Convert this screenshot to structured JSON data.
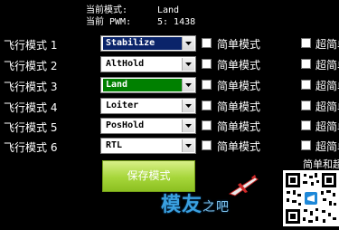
{
  "status": {
    "current_mode_label": "当前模式:",
    "current_mode_value": "Land",
    "current_pwm_label": "当前 PWM:",
    "current_pwm_value": "5: 1438"
  },
  "modes": [
    {
      "label": "飞行模式 1",
      "value": "Stabilize",
      "bg": "#0a246a",
      "simple": "简单模式",
      "super": "超简单模式"
    },
    {
      "label": "飞行模式 2",
      "value": "AltHold",
      "bg": "#ffffff",
      "simple": "简单模式",
      "super": "超简单模式"
    },
    {
      "label": "飞行模式 3",
      "value": "Land",
      "bg": "#008000",
      "simple": "简单模式",
      "super": "超简单模式"
    },
    {
      "label": "飞行模式 4",
      "value": "Loiter",
      "bg": "#ffffff",
      "simple": "简单模式",
      "super": "超简单模式"
    },
    {
      "label": "飞行模式 5",
      "value": "PosHold",
      "bg": "#ffffff",
      "simple": "简单模式",
      "super": "超简单模式"
    },
    {
      "label": "飞行模式 6",
      "value": "RTL",
      "bg": "#ffffff",
      "simple": "简单模式",
      "super": "超简单模式"
    }
  ],
  "save_button": "保存模式",
  "help_text": "简单和超简单",
  "watermark": {
    "main": "模友",
    "small": "之吧"
  }
}
